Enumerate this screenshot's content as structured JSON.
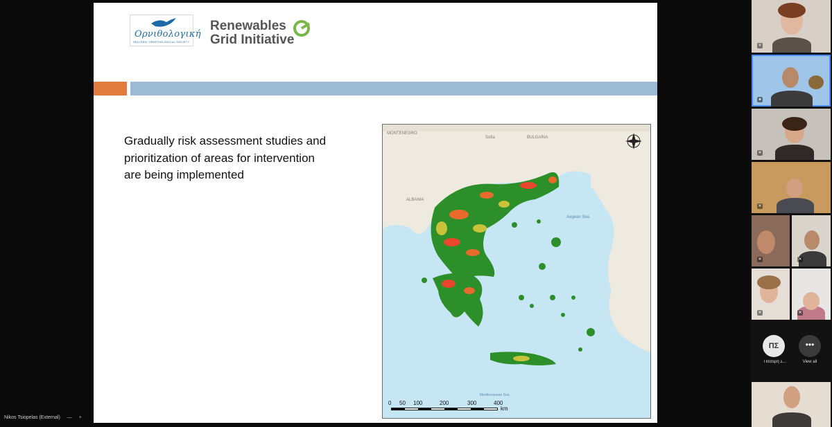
{
  "slide": {
    "logo_wordmark": "Ορνιθολογική",
    "logo_subtext": "HELLENIC ORNITHOLOGICAL SOCIETY",
    "partner_line1": "Renewables",
    "partner_line2": "Grid Initiative",
    "body_text": "Gradually risk assessment studies and prioritization of areas for intervention are being implemented",
    "accent_colors": {
      "orange": "#e07c3e",
      "blue": "#9cbad3",
      "rgi_green": "#7ab648"
    },
    "map": {
      "labels": [
        "MONTENEGRO",
        "Sofia",
        "BULGARIA",
        "ALBANIA",
        "Aegean Sea",
        "Mediterranean Sea"
      ],
      "scale_ticks": [
        "0",
        "50",
        "100",
        "200",
        "300",
        "400"
      ],
      "scale_unit": "km",
      "icon": "north-arrow-icon"
    }
  },
  "presenter": {
    "name": "Nikos Tsiopelas (External)",
    "controls": [
      "—",
      "+"
    ]
  },
  "participants": {
    "avatar_initials": "ΠΣ",
    "avatar_name": "Πιτσαρή Σ...",
    "view_all_label": "View all",
    "view_all_icon": "more-icon"
  }
}
